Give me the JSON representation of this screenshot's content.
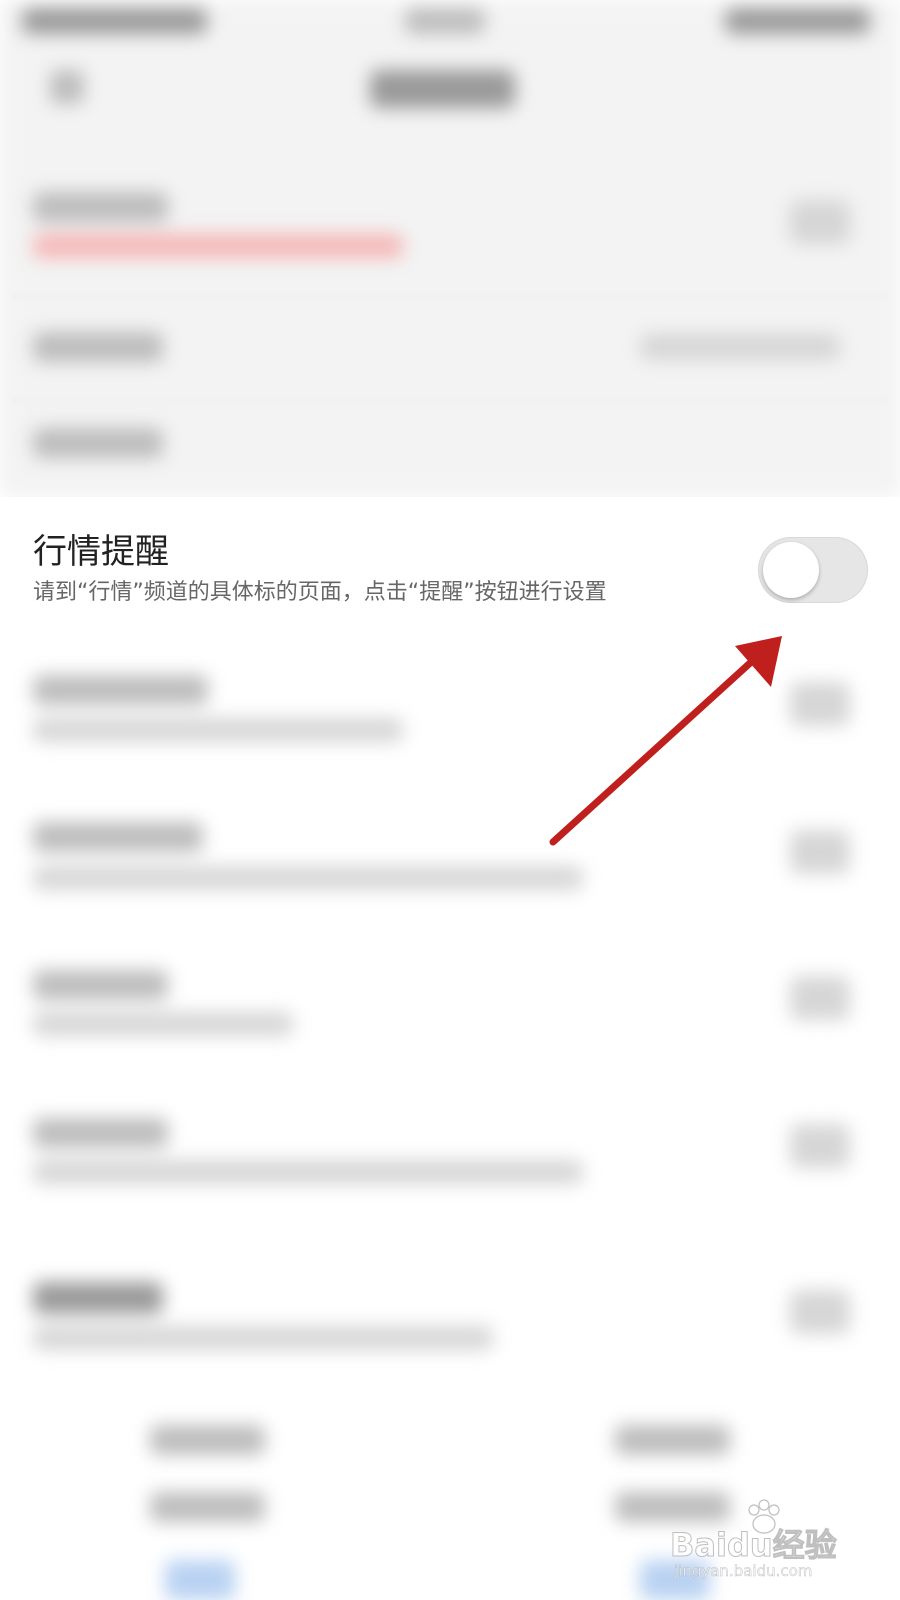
{
  "setting": {
    "title": "行情提醒",
    "description": "请到“行情”频道的具体标的页面，点击“提醒”按钮进行设置",
    "toggle_on": false
  },
  "colors": {
    "arrow": "#c0201d",
    "toggle_track": "#e6e6e6",
    "toggle_knob": "#ffffff",
    "title_text": "#222222",
    "desc_text": "#666666"
  },
  "watermark": {
    "brand": "Baidu经验",
    "url": "jingyan.baidu.com"
  }
}
